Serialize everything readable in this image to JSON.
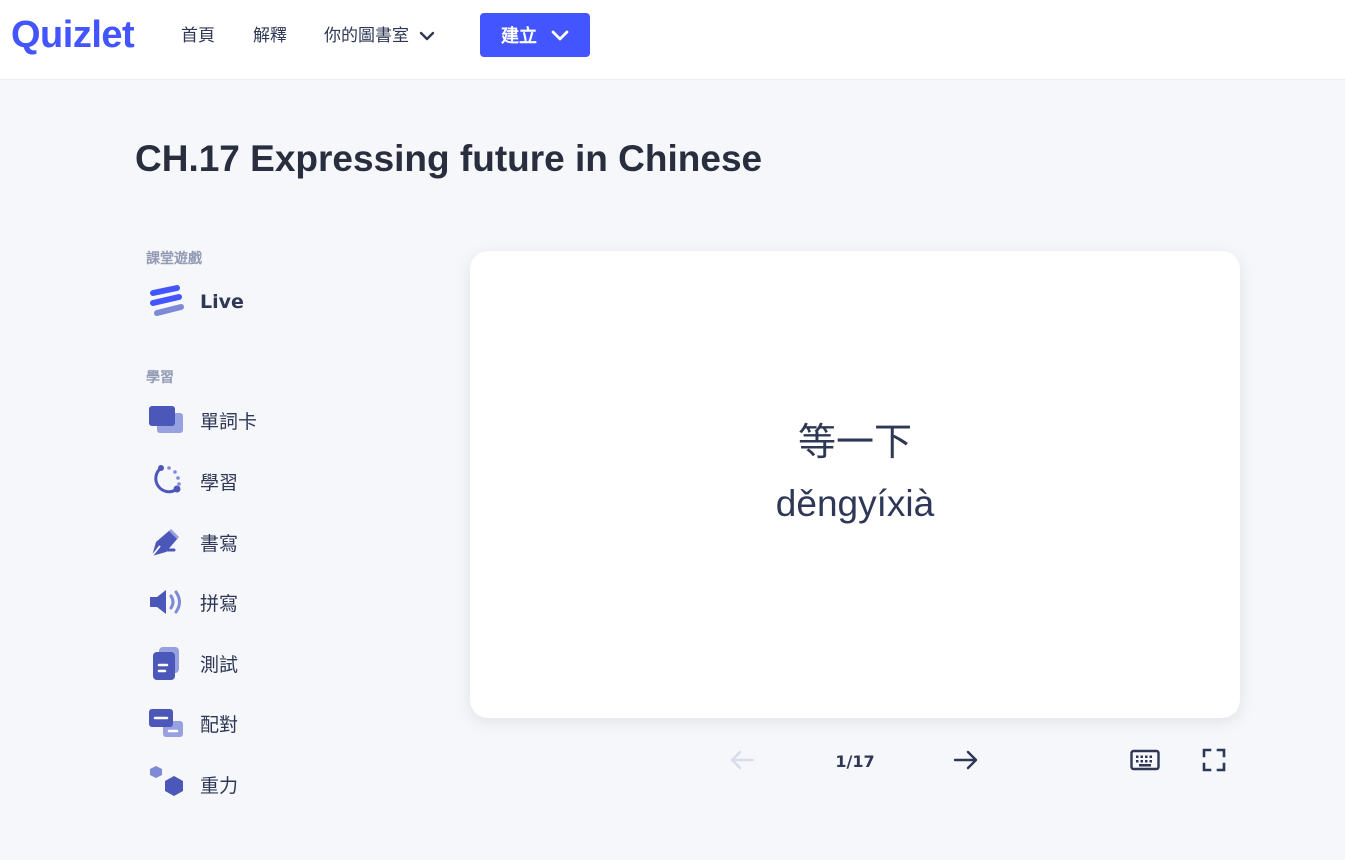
{
  "header": {
    "logo": "Quizlet",
    "nav": {
      "home": "首頁",
      "explain": "解釋",
      "library": "你的圖書室"
    },
    "create_label": "建立",
    "accent_color": "#4255ff"
  },
  "page": {
    "title": "CH.17 Expressing future in Chinese"
  },
  "sidebar": {
    "games_label": "課堂遊戲",
    "live_label": "Live",
    "study_label": "學習",
    "items": [
      {
        "label": "單詞卡",
        "icon": "flashcards-icon"
      },
      {
        "label": "學習",
        "icon": "learn-icon"
      },
      {
        "label": "書寫",
        "icon": "write-icon"
      },
      {
        "label": "拼寫",
        "icon": "spell-icon"
      },
      {
        "label": "測試",
        "icon": "test-icon"
      },
      {
        "label": "配對",
        "icon": "match-icon"
      },
      {
        "label": "重力",
        "icon": "gravity-icon"
      }
    ]
  },
  "card": {
    "term": "等一下",
    "pinyin": "děngyíxià"
  },
  "controls": {
    "counter": "1/17"
  }
}
